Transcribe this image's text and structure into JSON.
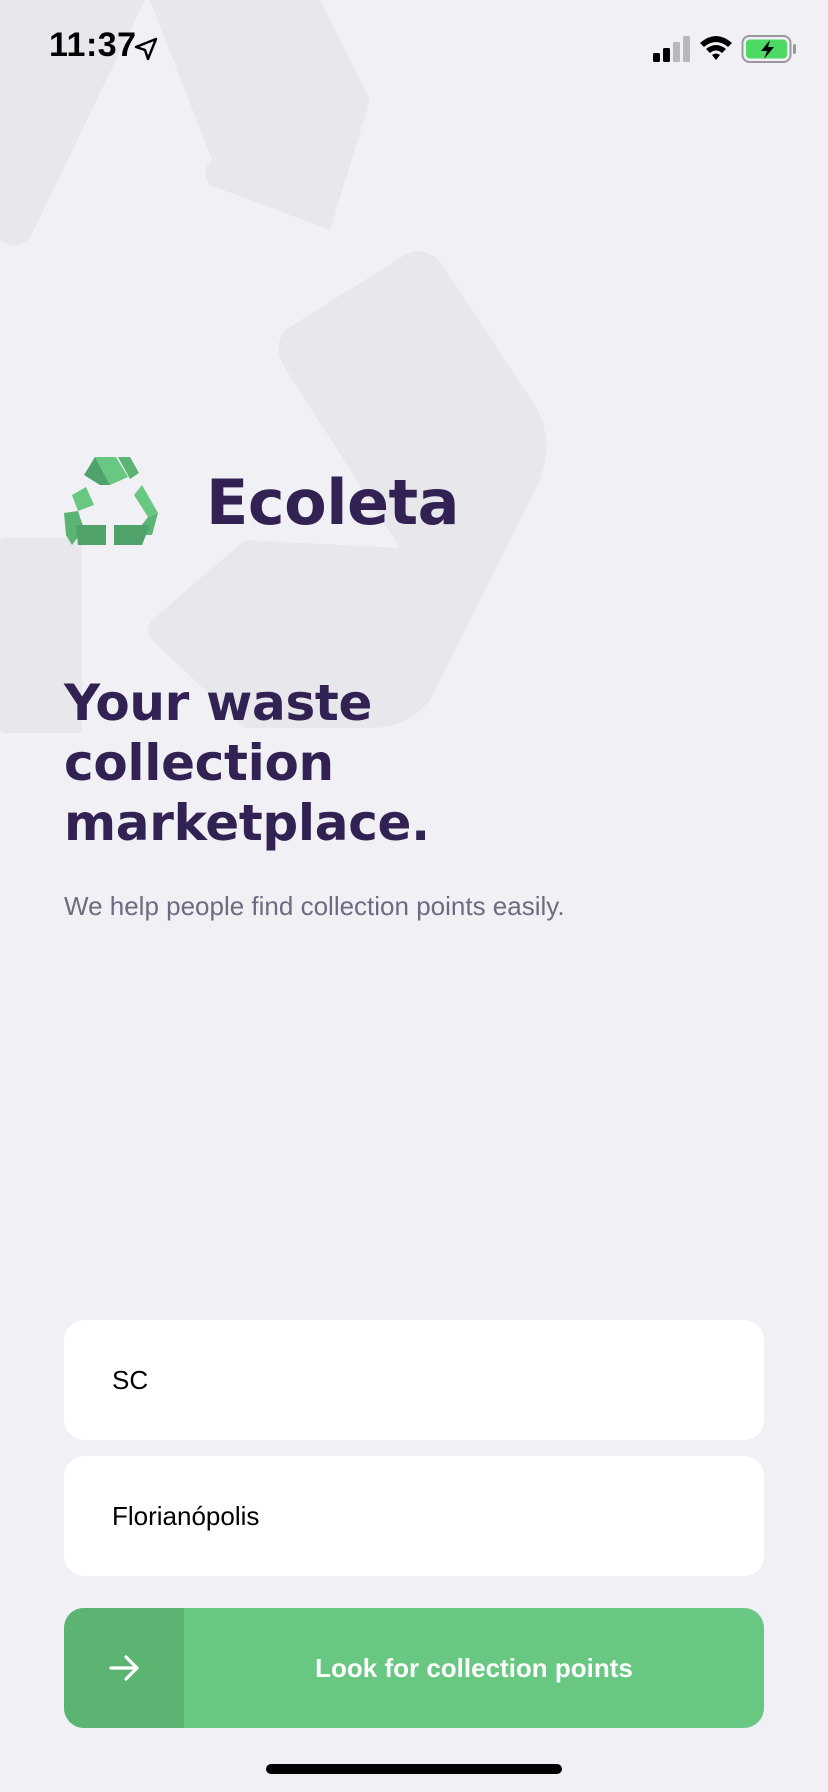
{
  "status_bar": {
    "time": "11:37"
  },
  "brand": {
    "name": "Ecoleta",
    "logo_icon": "recycle-icon"
  },
  "hero": {
    "title": "Your waste collection marketplace.",
    "subtitle": "We help people find collection points easily."
  },
  "form": {
    "uf_value": "SC",
    "city_value": "Florianópolis",
    "submit_label": "Look for collection points",
    "submit_icon": "arrow-right-icon"
  },
  "colors": {
    "background": "#F0F0F5",
    "title": "#322153",
    "text": "#6C6C80",
    "primary": "#34CB79",
    "button": "#68C882",
    "button_icon_box": "#5BB472"
  }
}
